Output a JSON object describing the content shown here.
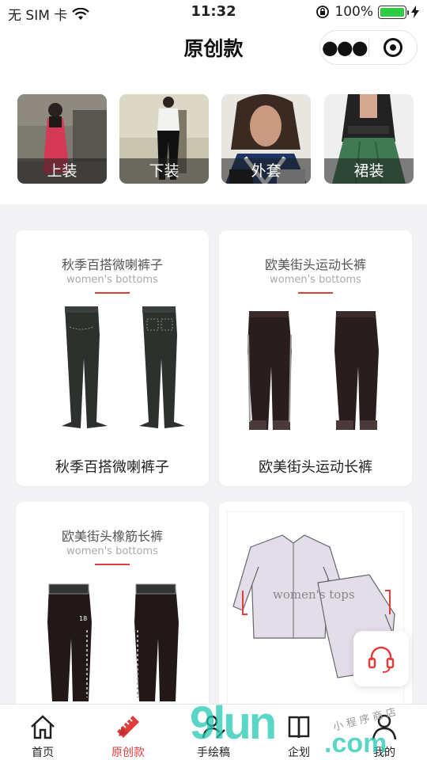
{
  "status_bar": {
    "carrier": "无 SIM 卡",
    "time": "11:32",
    "battery": "100%",
    "wifi_icon": "wifi-icon",
    "lock_icon": "orientation-lock-icon",
    "charging_icon": "charging-bolt-icon"
  },
  "nav": {
    "title": "原创款",
    "more_icon": "more-dots-icon",
    "close_icon": "target-circle-icon"
  },
  "categories": [
    {
      "label": "上装"
    },
    {
      "label": "下装"
    },
    {
      "label": "外套"
    },
    {
      "label": "裙装"
    }
  ],
  "products": [
    {
      "header": "秋季百搭微喇裤子",
      "subtitle": "women's bottoms",
      "name": "秋季百搭微喇裤子"
    },
    {
      "header": "欧美街头运动长裤",
      "subtitle": "women's bottoms",
      "name": "欧美街头运动长裤"
    },
    {
      "header": "欧美街头橡筋长裤",
      "subtitle": "women's bottoms",
      "name": ""
    },
    {
      "header": "",
      "subtitle": "women's tops",
      "name": ""
    }
  ],
  "floating": {
    "customer_service_icon": "headset-icon"
  },
  "tabbar": {
    "items": [
      {
        "label": "首页",
        "icon": "home-icon"
      },
      {
        "label": "原创款",
        "icon": "pencil-ruler-icon"
      },
      {
        "label": "手绘稿",
        "icon": "sketch-icon"
      },
      {
        "label": "企划",
        "icon": "book-icon"
      },
      {
        "label": "我的",
        "icon": "user-icon"
      }
    ],
    "active_index": 1,
    "accent": "#e03c3c"
  },
  "watermark": {
    "main": "9lun",
    "suffix": ".com",
    "script": "小 程 序 商 店"
  }
}
